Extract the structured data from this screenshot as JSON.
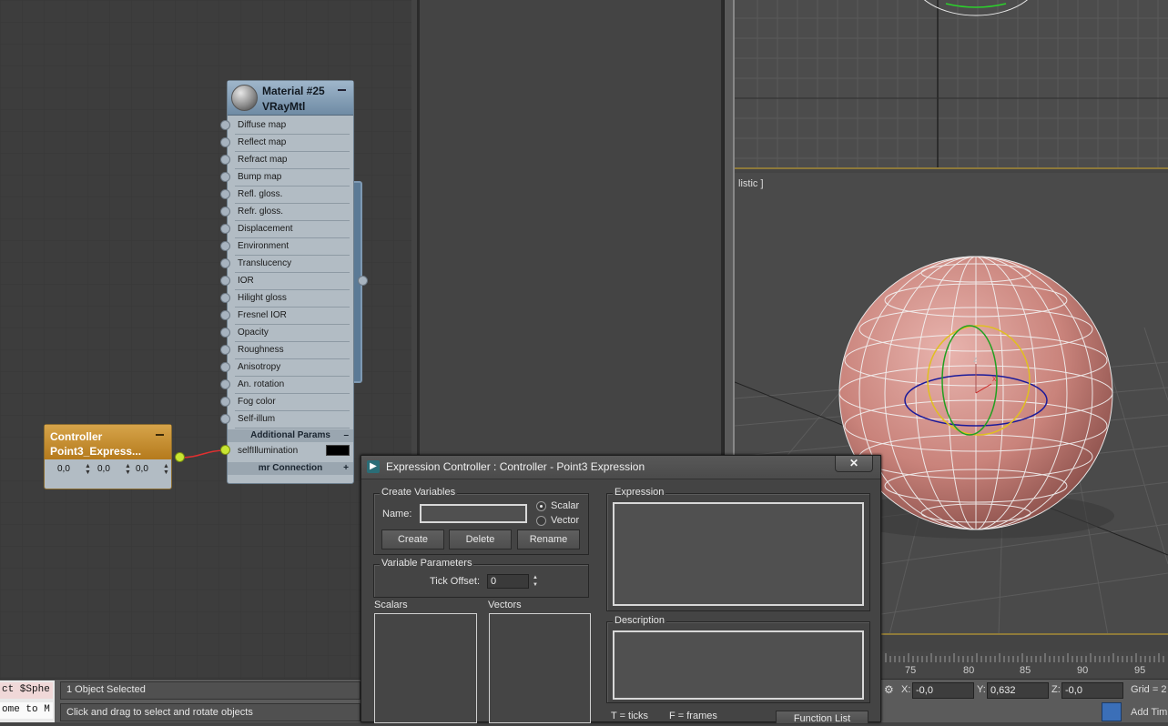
{
  "material_node": {
    "name": "Material #25",
    "type": "VRayMtl",
    "slots": [
      "Diffuse map",
      "Reflect map",
      "Refract map",
      "Bump map",
      "Refl. gloss.",
      "Refr. gloss.",
      "Displacement",
      "Environment",
      "Translucency",
      "IOR",
      "Hilight gloss",
      "Fresnel IOR",
      "Opacity",
      "Roughness",
      "Anisotropy",
      "An. rotation",
      "Fog color",
      "Self-illum"
    ],
    "additional_params_label": "Additional Params",
    "selfillum_label": "selfIllumination",
    "mr_connection_label": "mr Connection"
  },
  "controller_node": {
    "title": "Controller",
    "subtitle": "Point3_Express...",
    "values": [
      "0,0",
      "0,0",
      "0,0"
    ]
  },
  "viewport": {
    "label": "listic ]"
  },
  "timeline": {
    "ticks": [
      "75",
      "80",
      "85",
      "90",
      "95"
    ]
  },
  "status": {
    "maxscript_line1": "ct $Sphe",
    "maxscript_line2": "ome to M",
    "selection": "1 Object Selected",
    "prompt": "Click and drag to select and rotate objects",
    "x_label": "X:",
    "x_value": "-0,0",
    "y_label": "Y:",
    "y_value": "0,632",
    "z_label": "Z:",
    "z_value": "-0,0",
    "grid": "Grid = 2",
    "add_time": "Add Tim"
  },
  "expression_dialog": {
    "title": "Expression Controller : Controller - Point3 Expression",
    "close_label": "✕",
    "create_variables": {
      "group_title": "Create Variables",
      "name_label": "Name:",
      "name_value": "",
      "scalar_label": "Scalar",
      "vector_label": "Vector",
      "create_label": "Create",
      "delete_label": "Delete",
      "rename_label": "Rename"
    },
    "variable_parameters": {
      "group_title": "Variable Parameters",
      "tick_offset_label": "Tick Offset:",
      "tick_offset_value": "0"
    },
    "scalars_label": "Scalars",
    "vectors_label": "Vectors",
    "expression_label": "Expression",
    "description_label": "Description",
    "legend_ticks": "T = ticks",
    "legend_frames": "F = frames",
    "function_list_label": "Function List"
  }
}
